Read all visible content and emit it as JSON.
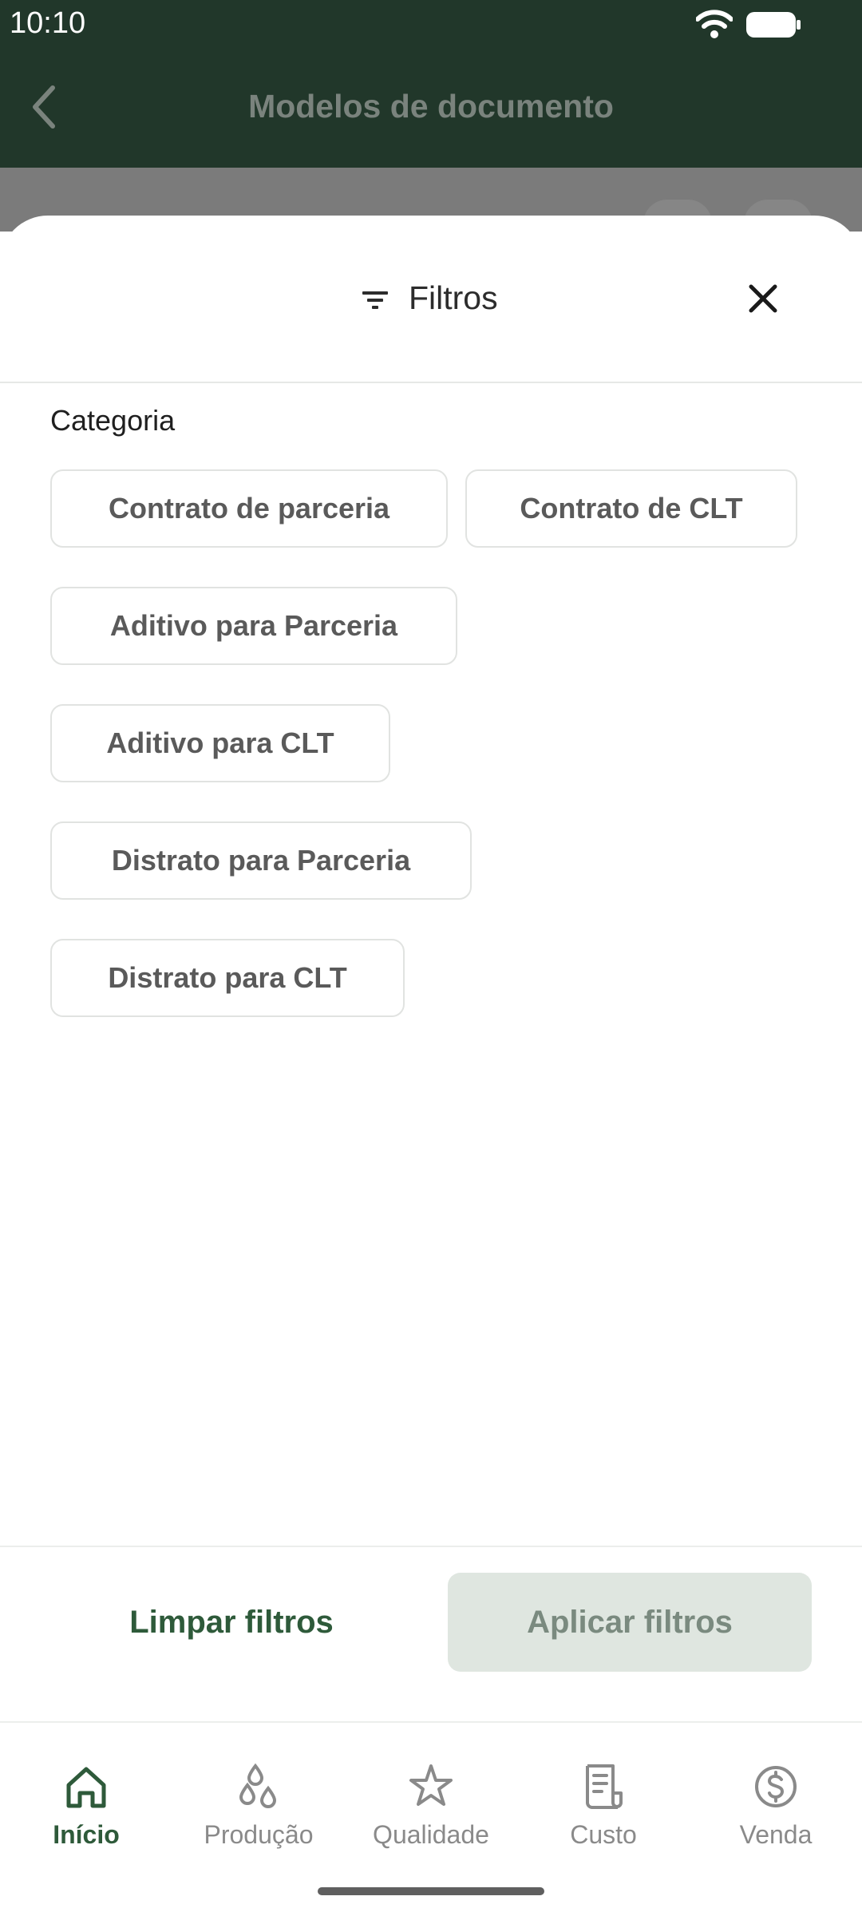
{
  "status_bar": {
    "time": "10:10",
    "wifi_icon": "wifi-icon",
    "battery_icon": "battery-icon"
  },
  "app_bar": {
    "title": "Modelos de documento",
    "back_icon": "chevron-left-icon"
  },
  "sheet": {
    "title": "Filtros",
    "filter_icon": "filter-icon",
    "close_icon": "close-icon",
    "section_label": "Categoria",
    "chips": [
      "Contrato de parceria",
      "Contrato de CLT",
      "Aditivo para Parceria",
      "Aditivo para CLT",
      "Distrato para Parceria",
      "Distrato para CLT"
    ],
    "clear_label": "Limpar filtros",
    "apply_label": "Aplicar filtros"
  },
  "bottom_nav": {
    "items": [
      {
        "label": "Início",
        "icon": "home-icon",
        "active": true
      },
      {
        "label": "Produção",
        "icon": "drops-icon",
        "active": false
      },
      {
        "label": "Qualidade",
        "icon": "star-icon",
        "active": false
      },
      {
        "label": "Custo",
        "icon": "receipt-icon",
        "active": false
      },
      {
        "label": "Venda",
        "icon": "dollar-circle-icon",
        "active": false
      }
    ]
  },
  "colors": {
    "primary": "#21372a",
    "accent_text": "#2e5a3a",
    "apply_bg": "#dfe6e0",
    "chip_border": "#e1e3e1"
  }
}
